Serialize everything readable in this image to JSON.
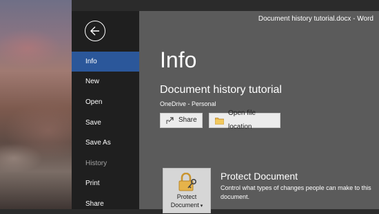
{
  "window": {
    "title": "Document history tutorial.docx  -  Word"
  },
  "sidebar": {
    "items": [
      {
        "label": "Info",
        "state": "active"
      },
      {
        "label": "New",
        "state": "normal"
      },
      {
        "label": "Open",
        "state": "normal"
      },
      {
        "label": "Save",
        "state": "normal"
      },
      {
        "label": "Save As",
        "state": "normal"
      },
      {
        "label": "History",
        "state": "disabled"
      },
      {
        "label": "Print",
        "state": "normal"
      },
      {
        "label": "Share",
        "state": "normal"
      }
    ],
    "back_icon": "back-arrow-circle-icon"
  },
  "main": {
    "heading": "Info",
    "document_title": "Document history tutorial",
    "location": "OneDrive - Personal",
    "buttons": {
      "share": {
        "label": "Share",
        "icon": "share-icon"
      },
      "open_location": {
        "label": "Open file location",
        "icon": "folder-icon"
      }
    },
    "protect": {
      "tile_line1": "Protect",
      "tile_line2": "Document",
      "icon": "lock-key-icon",
      "title": "Protect Document",
      "description": "Control what types of changes people can make to this document."
    }
  },
  "colors": {
    "accent": "#2b579a",
    "sidebar_bg": "#1f1f1f",
    "content_bg": "#5b5b5b"
  }
}
